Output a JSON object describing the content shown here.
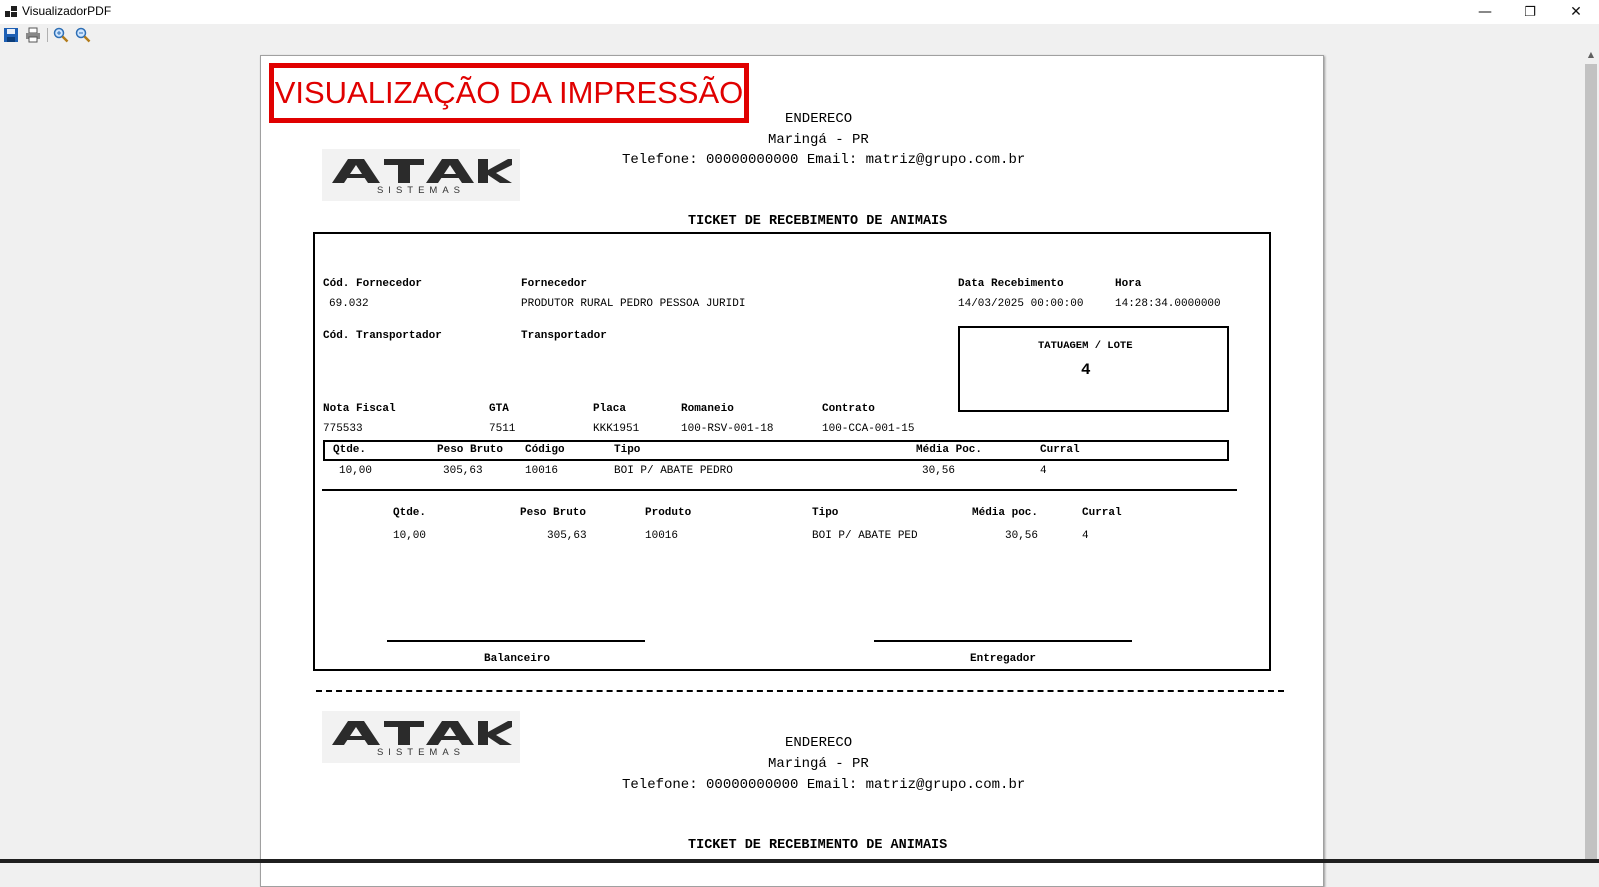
{
  "window": {
    "title": "VisualizadorPDF",
    "minimize": "—",
    "restore": "❐",
    "close": "✕"
  },
  "toolbar": {
    "icons": [
      "save-icon",
      "print-icon",
      "zoom-in-icon",
      "zoom-out-icon"
    ]
  },
  "watermark": "VISUALIZAÇÃO DA IMPRESSÃO",
  "company": {
    "address": "ENDERECO",
    "city": "Maringá - PR",
    "contact": "Telefone: 00000000000 Email: matriz@grupo.com.br",
    "logo_text": "ATAK",
    "logo_sub": "SISTEMAS"
  },
  "ticket": {
    "title": "TICKET DE RECEBIMENTO DE ANIMAIS",
    "labels": {
      "cod_fornecedor": "Cód. Fornecedor",
      "fornecedor": "Fornecedor",
      "data_recebimento": "Data Recebimento",
      "hora": "Hora",
      "cod_transportador": "Cód. Transportador",
      "transportador": "Transportador",
      "tatuagem": "TATUAGEM / LOTE",
      "nota_fiscal": "Nota Fiscal",
      "gta": "GTA",
      "placa": "Placa",
      "romaneio": "Romaneio",
      "contrato": "Contrato"
    },
    "values": {
      "cod_fornecedor": "69.032",
      "fornecedor": "PRODUTOR RURAL PEDRO PESSOA JURIDI",
      "data_recebimento": "14/03/2025  00:00:00",
      "hora": "14:28:34.0000000",
      "tatuagem": "4",
      "nota_fiscal": "775533",
      "gta": "7511",
      "placa": "KKK1951",
      "romaneio": "100-RSV-001-18",
      "contrato": "100-CCA-001-15"
    },
    "table1": {
      "headers": [
        "Qtde.",
        "Peso Bruto",
        "Código",
        "Tipo",
        "Média Poc.",
        "Curral"
      ],
      "row": [
        "10,00",
        "305,63",
        "10016",
        "BOI P/ ABATE PEDRO",
        "30,56",
        "4"
      ]
    },
    "table2": {
      "headers": [
        "Qtde.",
        "Peso Bruto",
        "Produto",
        "Tipo",
        "Média poc.",
        "Curral"
      ],
      "row": [
        "10,00",
        "305,63",
        "10016",
        "BOI P/ ABATE PED",
        "30,56",
        "4"
      ]
    },
    "signatures": {
      "left": "Balanceiro",
      "right": "Entregador"
    }
  }
}
